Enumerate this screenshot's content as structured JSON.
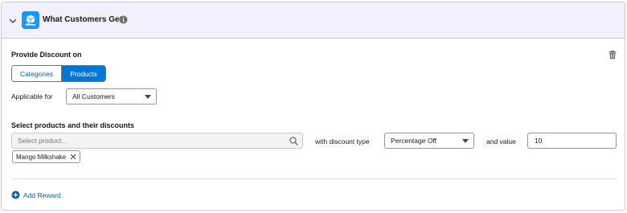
{
  "header": {
    "title": "What Customers Get"
  },
  "discount": {
    "section_title": "Provide Discount on",
    "tabs": [
      {
        "label": "Categories",
        "selected": false
      },
      {
        "label": "Products",
        "selected": true
      }
    ],
    "applicable_label": "Applicable for",
    "applicable_value": "All Customers"
  },
  "products": {
    "section_title": "Select products and their discounts",
    "search_placeholder": "Select product...",
    "selected_pill": "Mango Milkshake",
    "discount_type_label": "with discount type",
    "discount_type_value": "Percentage Off",
    "value_label": "and value",
    "value": "10"
  },
  "footer": {
    "add_reward_label": "Add Reward"
  },
  "colors": {
    "accent": "#0176d3",
    "header_bg": "#f3effc",
    "link": "#0b5cab"
  }
}
